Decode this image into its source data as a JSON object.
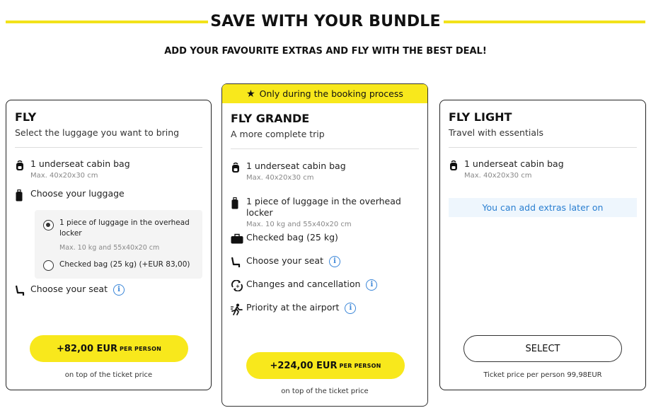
{
  "header": {
    "title": "SAVE WITH YOUR BUNDLE",
    "subtitle": "ADD YOUR FAVOURITE EXTRAS AND FLY WITH THE BEST DEAL!"
  },
  "colors": {
    "accent": "#f8e81c",
    "info": "#3a86d8",
    "note_bg": "#eef6fd"
  },
  "fly": {
    "title": "FLY",
    "subtitle": "Select the luggage you want to bring",
    "features": [
      {
        "icon": "backpack-icon",
        "label": "1 underseat cabin bag",
        "detail": "Max. 40x20x30 cm"
      },
      {
        "icon": "suitcase-icon",
        "label": "Choose your luggage"
      },
      {
        "icon": "seat-icon",
        "label": "Choose your seat"
      }
    ],
    "luggage_options": [
      {
        "label": "1 piece of luggage in the overhead locker",
        "detail": "Max. 10 kg and 55x40x20 cm",
        "selected": true
      },
      {
        "label": "Checked bag (25 kg) (+EUR 83,00)",
        "selected": false
      }
    ],
    "price": "+82,00 EUR",
    "per_person": "PER PERSON",
    "note": "on top of the ticket price"
  },
  "grande": {
    "ribbon": "Only during the booking process",
    "title": "FLY GRANDE",
    "subtitle": "A more complete trip",
    "features": [
      {
        "icon": "backpack-icon",
        "label": "1 underseat cabin bag",
        "detail": "Max. 40x20x30 cm"
      },
      {
        "icon": "trolley-icon",
        "label": "1 piece of luggage in the overhead locker",
        "detail": "Max. 10 kg and 55x40x20 cm"
      },
      {
        "icon": "checked-bag-icon",
        "label": "Checked bag (25 kg)"
      },
      {
        "icon": "seat-icon",
        "label": "Choose your seat"
      },
      {
        "icon": "changes-icon",
        "label": "Changes and cancellation"
      },
      {
        "icon": "priority-icon",
        "label": "Priority at the airport"
      }
    ],
    "price": "+224,00 EUR",
    "per_person": "PER PERSON",
    "note": "on top of the ticket price"
  },
  "light": {
    "title": "FLY LIGHT",
    "subtitle": "Travel with essentials",
    "features": [
      {
        "icon": "backpack-icon",
        "label": "1 underseat cabin bag",
        "detail": "Max. 40x20x30 cm"
      }
    ],
    "extras_note": "You can add extras later on",
    "button": "SELECT",
    "note": "Ticket price per person 99,98EUR"
  }
}
